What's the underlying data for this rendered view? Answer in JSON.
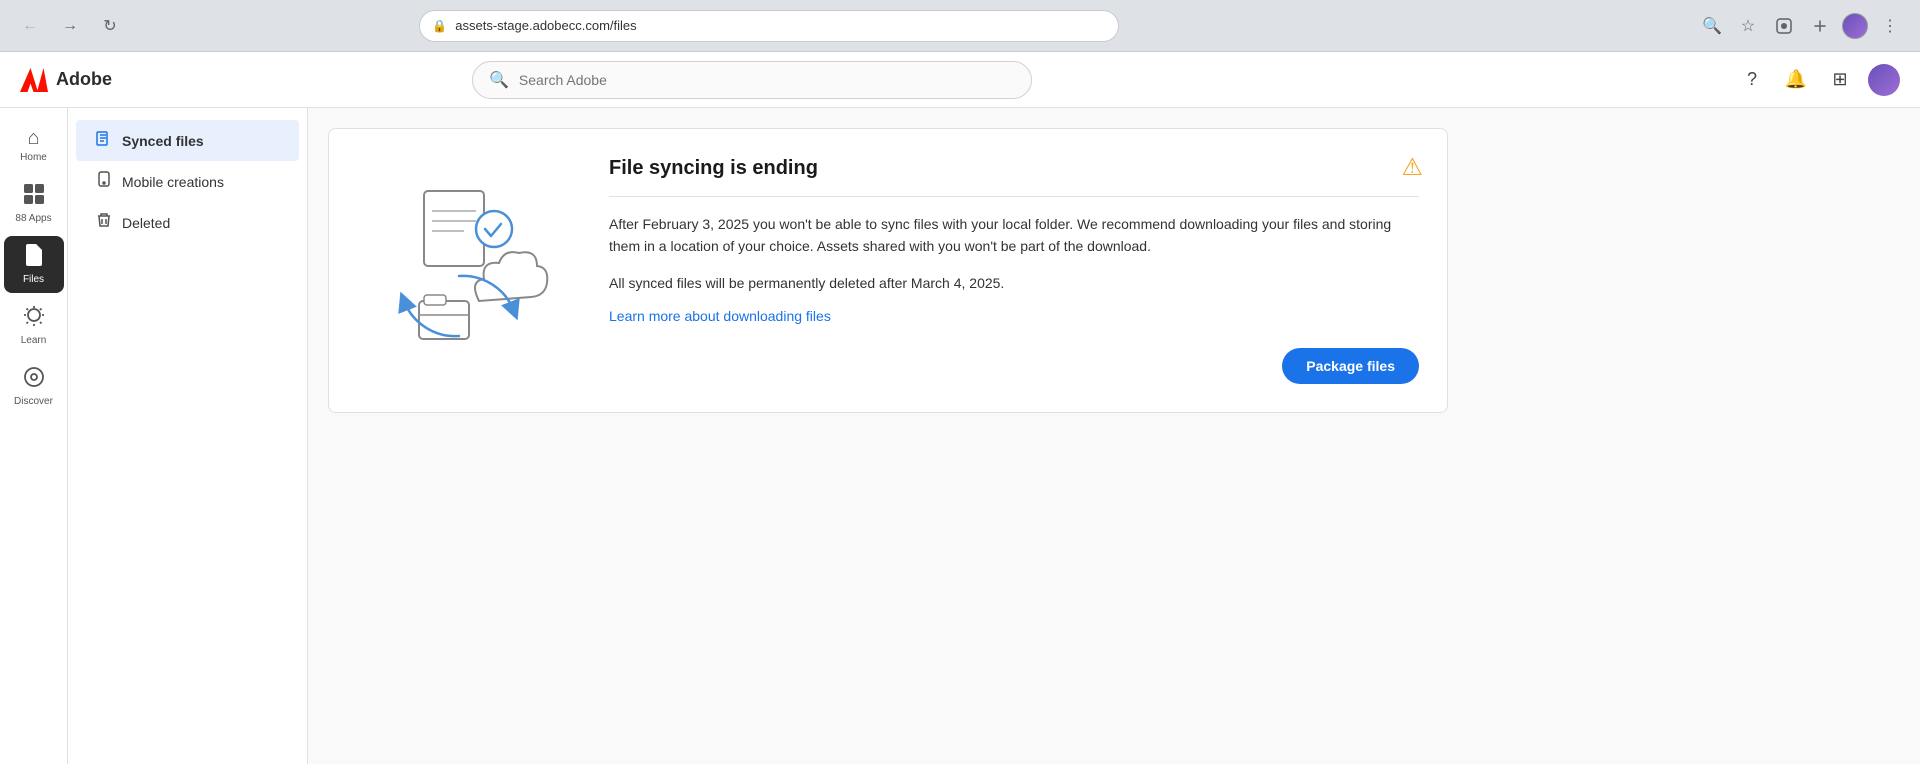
{
  "browser": {
    "url": "assets-stage.adobecc.com/files",
    "back_disabled": true,
    "forward_disabled": true
  },
  "topnav": {
    "logo_text": "Adobe",
    "search_placeholder": "Search Adobe"
  },
  "icon_rail": {
    "items": [
      {
        "id": "home",
        "label": "Home",
        "icon": "⌂",
        "active": false
      },
      {
        "id": "apps",
        "label": "88 Apps",
        "icon": "⊞",
        "active": false
      },
      {
        "id": "files",
        "label": "Files",
        "icon": "📄",
        "active": true
      },
      {
        "id": "learn",
        "label": "Learn",
        "icon": "💡",
        "active": false
      },
      {
        "id": "discover",
        "label": "Discover",
        "icon": "◎",
        "active": false
      }
    ]
  },
  "sidebar": {
    "items": [
      {
        "id": "synced-files",
        "label": "Synced files",
        "icon": "📋",
        "active": true
      },
      {
        "id": "mobile-creations",
        "label": "Mobile creations",
        "icon": "📱",
        "active": false
      },
      {
        "id": "deleted",
        "label": "Deleted",
        "icon": "🗑",
        "active": false
      }
    ]
  },
  "notice": {
    "title": "File syncing is ending",
    "divider": true,
    "body1": "After February 3, 2025 you won't be able to sync files with your local folder. We recommend downloading your files and storing them in a location of your choice. Assets shared with you won't be part of the download.",
    "body2": "All synced files will be permanently deleted after March 4, 2025.",
    "link_text": "Learn more about downloading files",
    "link_href": "#",
    "package_btn_label": "Package files",
    "warning_icon": "⚠"
  }
}
